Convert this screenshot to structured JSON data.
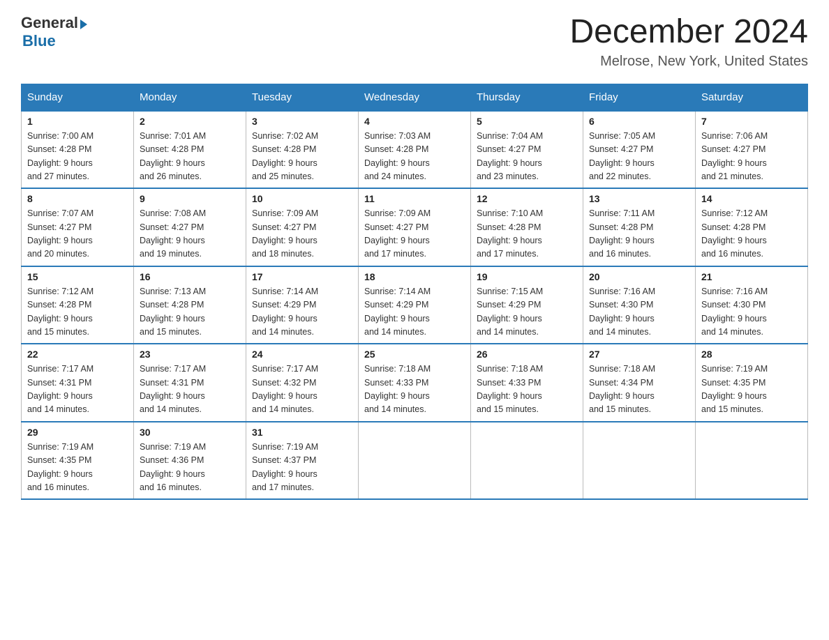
{
  "logo": {
    "general": "General",
    "blue": "Blue"
  },
  "title": "December 2024",
  "location": "Melrose, New York, United States",
  "weekdays": [
    "Sunday",
    "Monday",
    "Tuesday",
    "Wednesday",
    "Thursday",
    "Friday",
    "Saturday"
  ],
  "weeks": [
    [
      {
        "day": "1",
        "sunrise": "7:00 AM",
        "sunset": "4:28 PM",
        "daylight": "9 hours and 27 minutes."
      },
      {
        "day": "2",
        "sunrise": "7:01 AM",
        "sunset": "4:28 PM",
        "daylight": "9 hours and 26 minutes."
      },
      {
        "day": "3",
        "sunrise": "7:02 AM",
        "sunset": "4:28 PM",
        "daylight": "9 hours and 25 minutes."
      },
      {
        "day": "4",
        "sunrise": "7:03 AM",
        "sunset": "4:28 PM",
        "daylight": "9 hours and 24 minutes."
      },
      {
        "day": "5",
        "sunrise": "7:04 AM",
        "sunset": "4:27 PM",
        "daylight": "9 hours and 23 minutes."
      },
      {
        "day": "6",
        "sunrise": "7:05 AM",
        "sunset": "4:27 PM",
        "daylight": "9 hours and 22 minutes."
      },
      {
        "day": "7",
        "sunrise": "7:06 AM",
        "sunset": "4:27 PM",
        "daylight": "9 hours and 21 minutes."
      }
    ],
    [
      {
        "day": "8",
        "sunrise": "7:07 AM",
        "sunset": "4:27 PM",
        "daylight": "9 hours and 20 minutes."
      },
      {
        "day": "9",
        "sunrise": "7:08 AM",
        "sunset": "4:27 PM",
        "daylight": "9 hours and 19 minutes."
      },
      {
        "day": "10",
        "sunrise": "7:09 AM",
        "sunset": "4:27 PM",
        "daylight": "9 hours and 18 minutes."
      },
      {
        "day": "11",
        "sunrise": "7:09 AM",
        "sunset": "4:27 PM",
        "daylight": "9 hours and 17 minutes."
      },
      {
        "day": "12",
        "sunrise": "7:10 AM",
        "sunset": "4:28 PM",
        "daylight": "9 hours and 17 minutes."
      },
      {
        "day": "13",
        "sunrise": "7:11 AM",
        "sunset": "4:28 PM",
        "daylight": "9 hours and 16 minutes."
      },
      {
        "day": "14",
        "sunrise": "7:12 AM",
        "sunset": "4:28 PM",
        "daylight": "9 hours and 16 minutes."
      }
    ],
    [
      {
        "day": "15",
        "sunrise": "7:12 AM",
        "sunset": "4:28 PM",
        "daylight": "9 hours and 15 minutes."
      },
      {
        "day": "16",
        "sunrise": "7:13 AM",
        "sunset": "4:28 PM",
        "daylight": "9 hours and 15 minutes."
      },
      {
        "day": "17",
        "sunrise": "7:14 AM",
        "sunset": "4:29 PM",
        "daylight": "9 hours and 14 minutes."
      },
      {
        "day": "18",
        "sunrise": "7:14 AM",
        "sunset": "4:29 PM",
        "daylight": "9 hours and 14 minutes."
      },
      {
        "day": "19",
        "sunrise": "7:15 AM",
        "sunset": "4:29 PM",
        "daylight": "9 hours and 14 minutes."
      },
      {
        "day": "20",
        "sunrise": "7:16 AM",
        "sunset": "4:30 PM",
        "daylight": "9 hours and 14 minutes."
      },
      {
        "day": "21",
        "sunrise": "7:16 AM",
        "sunset": "4:30 PM",
        "daylight": "9 hours and 14 minutes."
      }
    ],
    [
      {
        "day": "22",
        "sunrise": "7:17 AM",
        "sunset": "4:31 PM",
        "daylight": "9 hours and 14 minutes."
      },
      {
        "day": "23",
        "sunrise": "7:17 AM",
        "sunset": "4:31 PM",
        "daylight": "9 hours and 14 minutes."
      },
      {
        "day": "24",
        "sunrise": "7:17 AM",
        "sunset": "4:32 PM",
        "daylight": "9 hours and 14 minutes."
      },
      {
        "day": "25",
        "sunrise": "7:18 AM",
        "sunset": "4:33 PM",
        "daylight": "9 hours and 14 minutes."
      },
      {
        "day": "26",
        "sunrise": "7:18 AM",
        "sunset": "4:33 PM",
        "daylight": "9 hours and 15 minutes."
      },
      {
        "day": "27",
        "sunrise": "7:18 AM",
        "sunset": "4:34 PM",
        "daylight": "9 hours and 15 minutes."
      },
      {
        "day": "28",
        "sunrise": "7:19 AM",
        "sunset": "4:35 PM",
        "daylight": "9 hours and 15 minutes."
      }
    ],
    [
      {
        "day": "29",
        "sunrise": "7:19 AM",
        "sunset": "4:35 PM",
        "daylight": "9 hours and 16 minutes."
      },
      {
        "day": "30",
        "sunrise": "7:19 AM",
        "sunset": "4:36 PM",
        "daylight": "9 hours and 16 minutes."
      },
      {
        "day": "31",
        "sunrise": "7:19 AM",
        "sunset": "4:37 PM",
        "daylight": "9 hours and 17 minutes."
      },
      null,
      null,
      null,
      null
    ]
  ]
}
